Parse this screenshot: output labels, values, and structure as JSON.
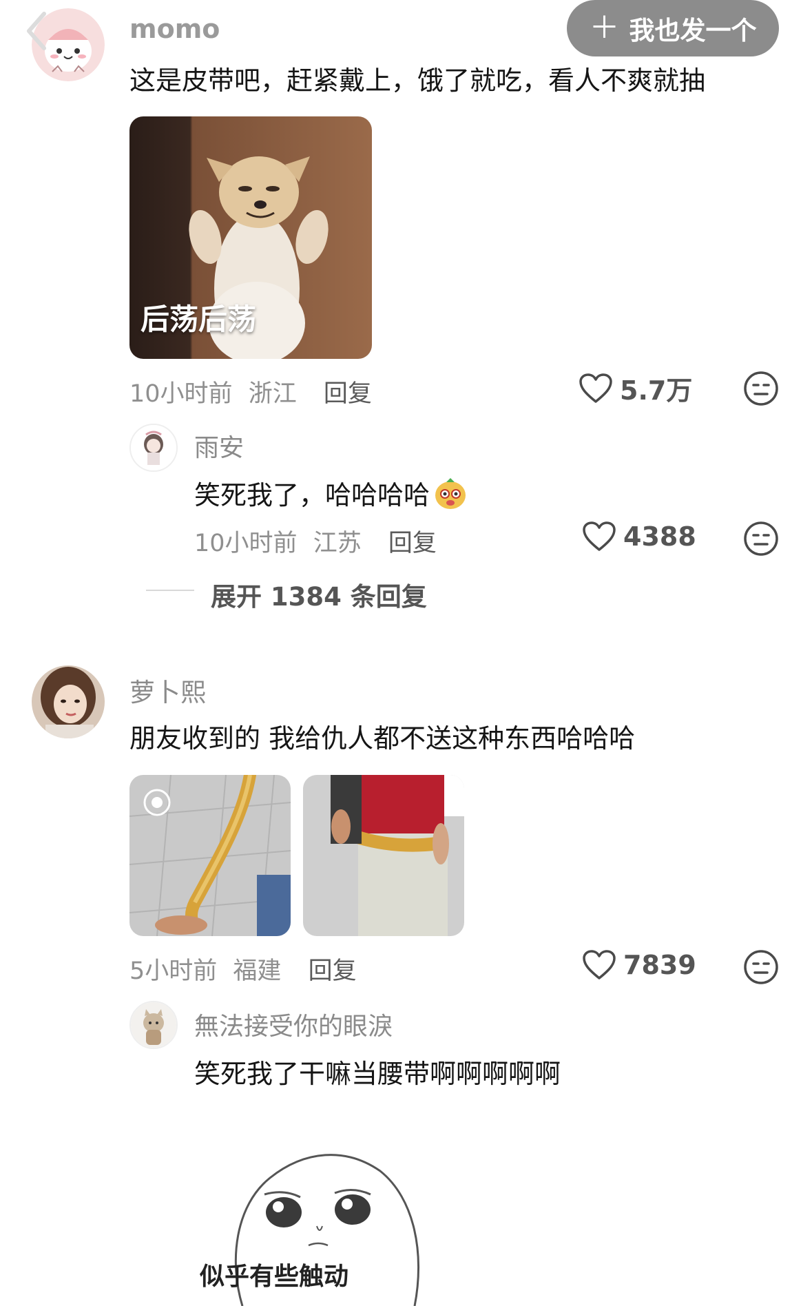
{
  "header": {
    "post_button_label": "我也发一个",
    "post_button_plus": "＋"
  },
  "comments": [
    {
      "username": "momo",
      "text": "这是皮带吧，赶紧戴上，饿了就吃，看人不爽就抽",
      "image_caption": "后荡后荡",
      "time": "10小时前",
      "location": "浙江",
      "reply_label": "回复",
      "likes": "5.7万",
      "replies": [
        {
          "username": "雨安",
          "text": "笑死我了，哈哈哈哈",
          "time": "10小时前",
          "location": "江苏",
          "reply_label": "回复",
          "likes": "4388"
        }
      ],
      "expand_label": "展开 1384 条回复"
    },
    {
      "username": "萝卜熙",
      "text": "朋友收到的 我给仇人都不送这种东西哈哈哈",
      "time": "5小时前",
      "location": "福建",
      "reply_label": "回复",
      "likes": "7839",
      "replies": [
        {
          "username": "無法接受你的眼淚",
          "text": "笑死我了干嘛当腰带啊啊啊啊啊",
          "sticker_caption": "似乎有些触动"
        }
      ]
    }
  ],
  "colors": {
    "post_button_bg": "#8c8c8c",
    "username": "#8a8a8a",
    "meta": "#8f8f8f",
    "text": "#151515"
  },
  "icons": [
    "back-icon",
    "plus-icon",
    "heart-icon",
    "dislike-face-icon",
    "sticker-face-icon"
  ]
}
